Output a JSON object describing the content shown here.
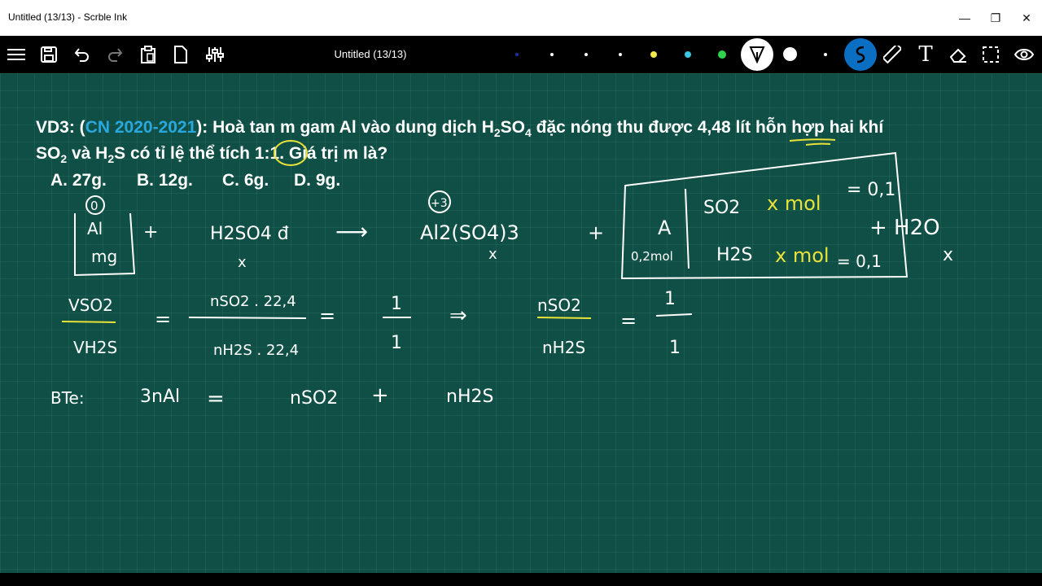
{
  "window": {
    "title": "Untitled (13/13) - Scrble Ink",
    "minimize": "—",
    "restore": "❐",
    "close": "✕"
  },
  "toolbar": {
    "doc_title": "Untitled (13/13)",
    "icons": [
      "menu-icon",
      "save-icon",
      "undo-icon",
      "redo-icon",
      "paste-icon",
      "new-page-icon",
      "settings-sliders-icon",
      "pen-tip-icon",
      "brush-size-icon",
      "stroke-style-icon",
      "ruler-icon",
      "text-icon",
      "eraser-icon",
      "select-icon",
      "view-icon"
    ],
    "palette": [
      "#1b2fa8",
      "#ffffff",
      "#ffffff",
      "#ffffff",
      "#f2e94a",
      "#39c6e0",
      "#2fd34d"
    ]
  },
  "question": {
    "prefix": "VD3: (",
    "source": "CN 2020-2021",
    "line1_rest": "): Hoà tan m gam Al vào dung dịch H",
    "sub2a": "2",
    "so": "SO",
    "sub4": "4",
    "line1_end": " đặc nóng thu được 4,48 lít hỗn hợp hai khí",
    "so2_a": "SO",
    "sub2b": "2",
    "line2_mid": " và H",
    "sub2c": "2",
    "line2_end": "S có tỉ lệ thể tích 1:1. Giá trị m là?"
  },
  "options": {
    "a": "A. 27g.",
    "b": "B. 12g.",
    "c": "C. 6g.",
    "d": "D. 9g."
  },
  "handwriting": {
    "ox_al": "0",
    "al": "Al",
    "mg": "mg",
    "plus1": "+",
    "h2so4": "H2SO4 đ",
    "x1": "x",
    "arrow1": "⟶",
    "ox_al2": "+3",
    "al2so43": "Al2(SO4)3",
    "x2": "x",
    "plus2": "+",
    "box_a": "A",
    "box_mol": "0,2mol",
    "so2": "SO2",
    "xmol1": "x mol",
    "eq01a": "= 0,1",
    "h2s": "H2S",
    "xmol2": "x mol",
    "eq01b": "= 0,1",
    "h2o": "+ H2O",
    "mark": "x",
    "vso2": "VSO2",
    "vh2s": "VH2S",
    "eq1": "=",
    "nso2_224": "nSO2 . 22,4",
    "nh2s_224": "nH2S . 22,4",
    "eq2": "=",
    "one_a": "1",
    "one_b": "1",
    "implies": "⇒",
    "nso2": "nSO2",
    "nh2s": "nH2S",
    "eq3": "=",
    "one_c": "1",
    "one_d": "1",
    "bte": "BTe:",
    "three_nal": "3nAl",
    "eq4": "=",
    "nso2_b": "nSO2",
    "plus3": "+",
    "nh2s_b": "nH2S"
  }
}
